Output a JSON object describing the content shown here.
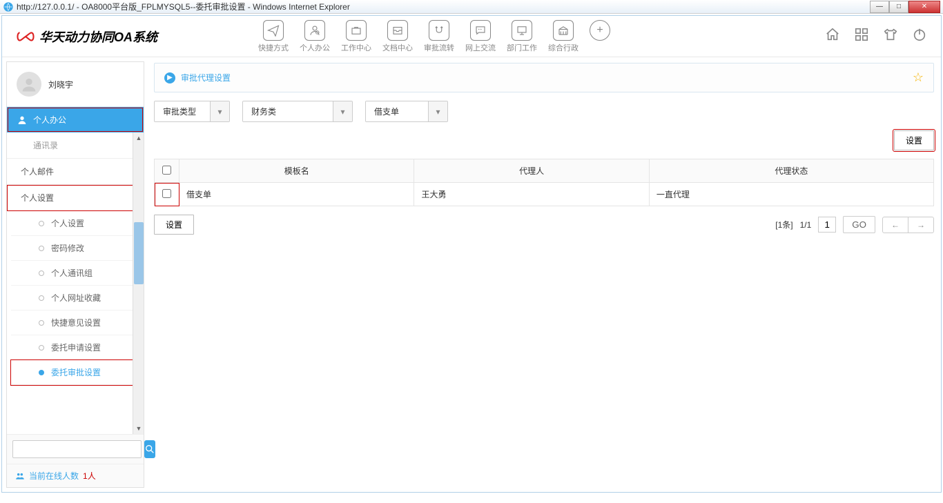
{
  "titlebar": {
    "url_prefix": "http://127.0.0.1/",
    "title": " - OA8000平台版_FPLMYSQL5--委托审批设置 - Windows Internet Explorer"
  },
  "logo": {
    "text": "华天动力协同OA系统"
  },
  "topnav": {
    "items": [
      {
        "label": "快捷方式"
      },
      {
        "label": "个人办公"
      },
      {
        "label": "工作中心"
      },
      {
        "label": "文档中心"
      },
      {
        "label": "审批流转"
      },
      {
        "label": "网上交流"
      },
      {
        "label": "部门工作"
      },
      {
        "label": "综合行政"
      }
    ]
  },
  "user": {
    "name": "刘晓宇"
  },
  "sidebar": {
    "category": "个人办公",
    "group_top": "通讯录",
    "group_mail": "个人邮件",
    "group_settings": "个人设置",
    "subs": [
      {
        "label": "个人设置"
      },
      {
        "label": "密码修改"
      },
      {
        "label": "个人通讯组"
      },
      {
        "label": "个人网址收藏"
      },
      {
        "label": "快捷意见设置"
      },
      {
        "label": "委托申请设置"
      },
      {
        "label": "委托审批设置"
      }
    ],
    "online_label": "当前在线人数 ",
    "online_count": "1人"
  },
  "panel": {
    "title": "审批代理设置",
    "filters": {
      "f1": "审批类型",
      "f2": "财务类",
      "f3": "借支单"
    },
    "set_button": "设置",
    "table": {
      "headers": {
        "template": "模板名",
        "agent": "代理人",
        "status": "代理状态"
      },
      "rows": [
        {
          "template": "借支单",
          "agent": "王大勇",
          "status": "一直代理"
        }
      ]
    },
    "footer": {
      "set_button": "设置",
      "count_label": "[1条]",
      "page_ratio": "1/1",
      "page_input": "1",
      "go": "GO"
    }
  }
}
